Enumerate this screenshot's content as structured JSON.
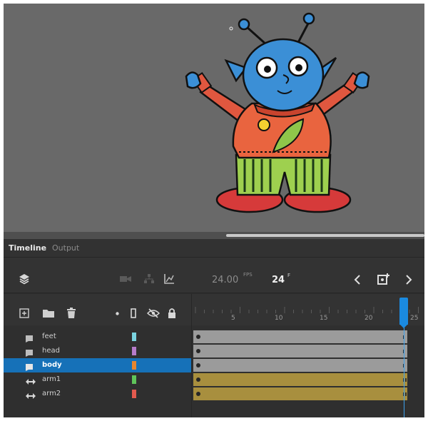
{
  "panel": {
    "tabs": [
      {
        "label": "Timeline",
        "active": true
      },
      {
        "label": "Output",
        "active": false
      }
    ]
  },
  "toolbar": {
    "fps_value": "24.00",
    "fps_unit": "FPS",
    "frame_value": "24",
    "frame_unit": "F",
    "icons": [
      "layers-stack-icon",
      "camera-icon",
      "layer-depth-icon",
      "graph-icon",
      "prev-keyframe-icon",
      "insert-keyframe-icon",
      "next-keyframe-icon"
    ]
  },
  "layer_header": {
    "icons": [
      "new-layer-icon",
      "new-folder-icon",
      "delete-icon",
      "highlight-dot-icon",
      "outline-icon",
      "visibility-icon",
      "lock-icon"
    ]
  },
  "ruler": {
    "labels": [
      "5",
      "10",
      "15",
      "20",
      "25"
    ]
  },
  "layers": [
    {
      "name": "feet",
      "color": "#7ad3e0",
      "type": "shape",
      "selected": false
    },
    {
      "name": "head",
      "color": "#b67ccb",
      "type": "shape",
      "selected": false
    },
    {
      "name": "body",
      "color": "#e8862f",
      "type": "shape",
      "selected": true
    },
    {
      "name": "arm1",
      "color": "#5fc45a",
      "type": "symbol",
      "selected": false
    },
    {
      "name": "arm2",
      "color": "#e25a4e",
      "type": "symbol",
      "selected": false
    }
  ],
  "colors": {
    "stage": "#696969",
    "selection": "#1671b8",
    "playhead": "#1a8ae0",
    "shape_span": "#9b9b9b",
    "symbol_span": "#a88f3e"
  }
}
